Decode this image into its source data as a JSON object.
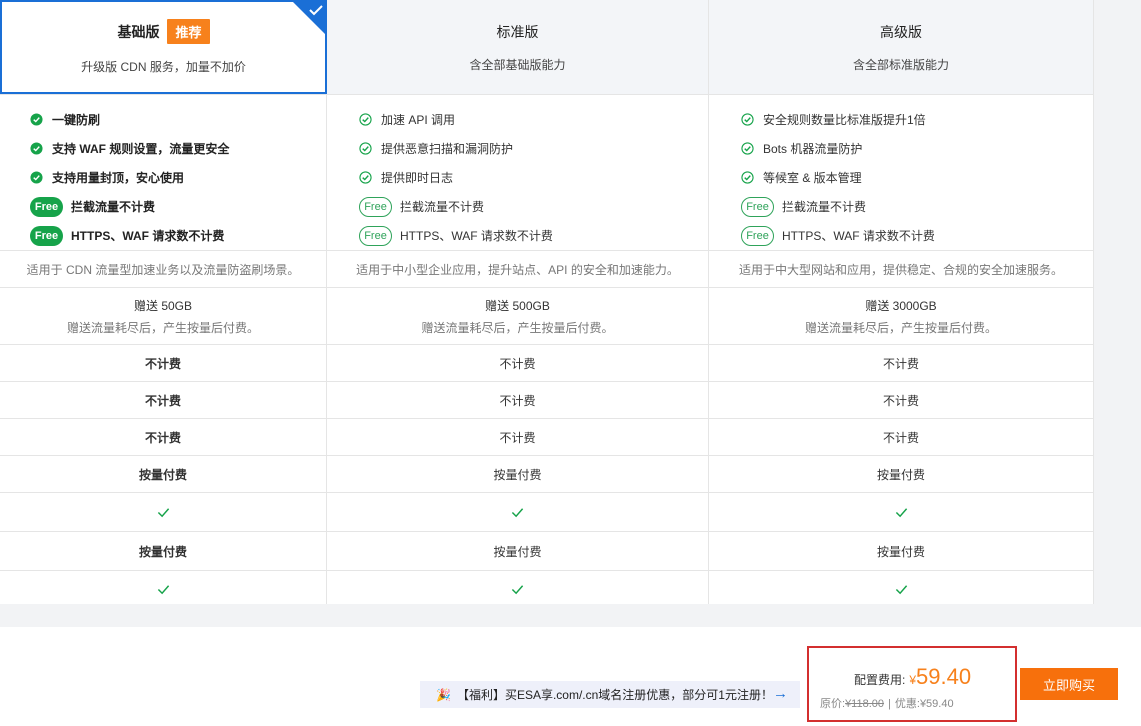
{
  "plans": [
    {
      "name": "基础版",
      "badge": "推荐",
      "subtitle": "升级版 CDN 服务，加量不加价",
      "features": [
        {
          "text": "一键防刷",
          "type": "check"
        },
        {
          "text": "支持 WAF 规则设置，流量更安全",
          "type": "check"
        },
        {
          "text": "支持用量封顶，安心使用",
          "type": "check"
        },
        {
          "text": "拦截流量不计费",
          "type": "free",
          "pill": "Free"
        },
        {
          "text": "HTTPS、WAF 请求数不计费",
          "type": "free",
          "pill": "Free"
        }
      ],
      "scenario": "适用于 CDN 流量型加速业务以及流量防盗刷场景。",
      "gift_title": "赠送 50GB",
      "gift_note": "赠送流量耗尽后，产生按量后付费。",
      "rows": [
        "不计费",
        "不计费",
        "不计费",
        "按量付费",
        "check",
        "按量付费",
        "check"
      ]
    },
    {
      "name": "标准版",
      "badge": "",
      "subtitle": "含全部基础版能力",
      "features": [
        {
          "text": "加速 API 调用",
          "type": "check"
        },
        {
          "text": "提供恶意扫描和漏洞防护",
          "type": "check"
        },
        {
          "text": "提供即时日志",
          "type": "check"
        },
        {
          "text": "拦截流量不计费",
          "type": "free",
          "pill": "Free"
        },
        {
          "text": "HTTPS、WAF 请求数不计费",
          "type": "free",
          "pill": "Free"
        }
      ],
      "scenario": "适用于中小型企业应用，提升站点、API 的安全和加速能力。",
      "gift_title": "赠送 500GB",
      "gift_note": "赠送流量耗尽后，产生按量后付费。",
      "rows": [
        "不计费",
        "不计费",
        "不计费",
        "按量付费",
        "check",
        "按量付费",
        "check"
      ]
    },
    {
      "name": "高级版",
      "badge": "",
      "subtitle": "含全部标准版能力",
      "features": [
        {
          "text": "安全规则数量比标准版提升1倍",
          "type": "check"
        },
        {
          "text": "Bots 机器流量防护",
          "type": "check"
        },
        {
          "text": "等候室 & 版本管理",
          "type": "check"
        },
        {
          "text": "拦截流量不计费",
          "type": "free",
          "pill": "Free"
        },
        {
          "text": "HTTPS、WAF 请求数不计费",
          "type": "free",
          "pill": "Free"
        }
      ],
      "scenario": "适用于中大型网站和应用，提供稳定、合规的安全加速服务。",
      "gift_title": "赠送 3000GB",
      "gift_note": "赠送流量耗尽后，产生按量后付费。",
      "rows": [
        "不计费",
        "不计费",
        "不计费",
        "按量付费",
        "check",
        "按量付费",
        "check"
      ]
    }
  ],
  "promo": {
    "icon": "party-popper-icon",
    "text": "【福利】买ESA享.com/.cn域名注册优惠，部分可1元注册！"
  },
  "fee": {
    "label": "配置费用:",
    "currency": "¥",
    "amount": "59.40",
    "original_label": "原价:",
    "original_value": "¥118.00",
    "separator": "|",
    "discount_label": "优惠:",
    "discount_value": "¥59.40"
  },
  "buy_button": "立即购买",
  "colors": {
    "selected_border": "#1a6fd6",
    "badge": "#f7811c",
    "check": "#16a34a",
    "price": "#f7811c",
    "buy": "#f7700c",
    "highlight_box": "#d32f2f"
  }
}
